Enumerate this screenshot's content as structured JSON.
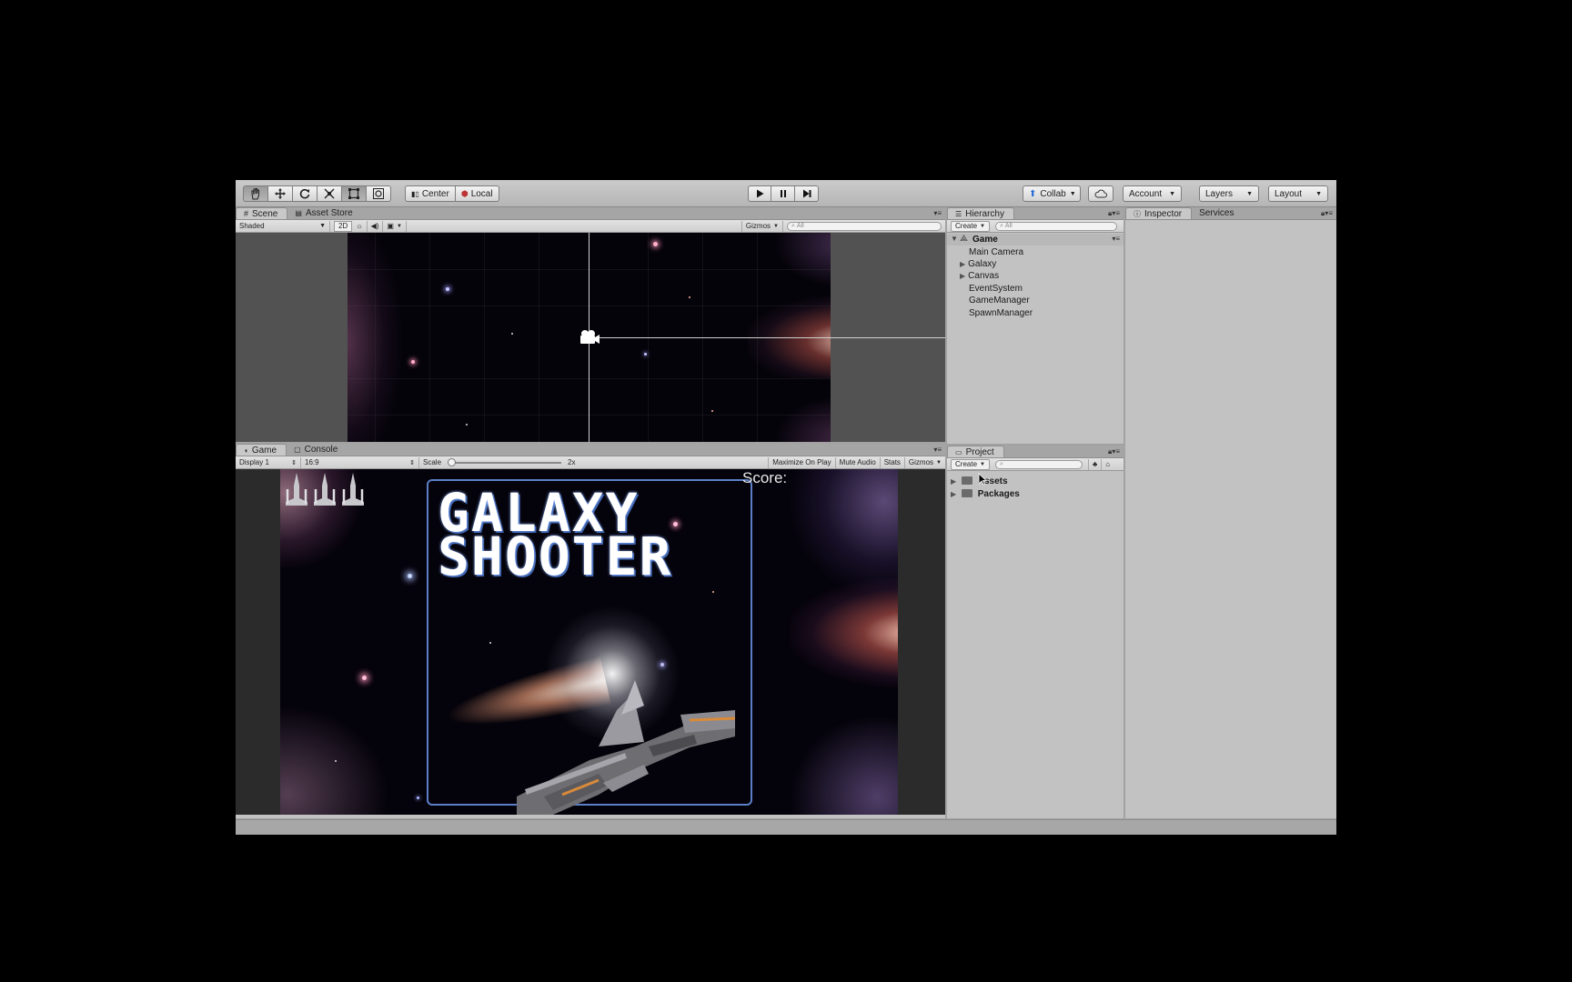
{
  "toolbar": {
    "transform_tools": [
      "hand-tool",
      "move-tool",
      "rotate-tool",
      "scale-tool",
      "rect-tool",
      "transform-tool"
    ],
    "pivot_mode": "Center",
    "pivot_rotation": "Local",
    "collab_label": "Collab",
    "account_label": "Account",
    "layers_label": "Layers",
    "layout_label": "Layout"
  },
  "scene_panel": {
    "tabs": [
      "Scene",
      "Asset Store"
    ],
    "draw_mode": "Shaded",
    "mode_2d": "2D",
    "gizmos_label": "Gizmos",
    "search_placeholder": "All"
  },
  "game_panel": {
    "tabs": [
      "Game",
      "Console"
    ],
    "display": "Display 1",
    "aspect": "16:9",
    "scale_label": "Scale",
    "scale_value": "2x",
    "scale_fraction": 0.0,
    "options": [
      "Maximize On Play",
      "Mute Audio",
      "Stats",
      "Gizmos"
    ],
    "title_line1": "GALAXY",
    "title_line2": "SHOOTER",
    "score_label": "Score:",
    "lives": 3
  },
  "hierarchy": {
    "tab": "Hierarchy",
    "create_label": "Create",
    "search_placeholder": "All",
    "scene_name": "Game",
    "items": [
      {
        "label": "Main Camera",
        "expandable": false
      },
      {
        "label": "Galaxy",
        "expandable": true
      },
      {
        "label": "Canvas",
        "expandable": true
      },
      {
        "label": "EventSystem",
        "expandable": false
      },
      {
        "label": "GameManager",
        "expandable": false
      },
      {
        "label": "SpawnManager",
        "expandable": false
      }
    ]
  },
  "project": {
    "tab": "Project",
    "create_label": "Create",
    "folders": [
      "Assets",
      "Packages"
    ]
  },
  "inspector": {
    "tabs": [
      "Inspector",
      "Services"
    ]
  },
  "colors": {
    "editor_bg": "#a2a2a2",
    "panel_bg": "#c2c2c2",
    "title_border": "#5c7fc7"
  }
}
